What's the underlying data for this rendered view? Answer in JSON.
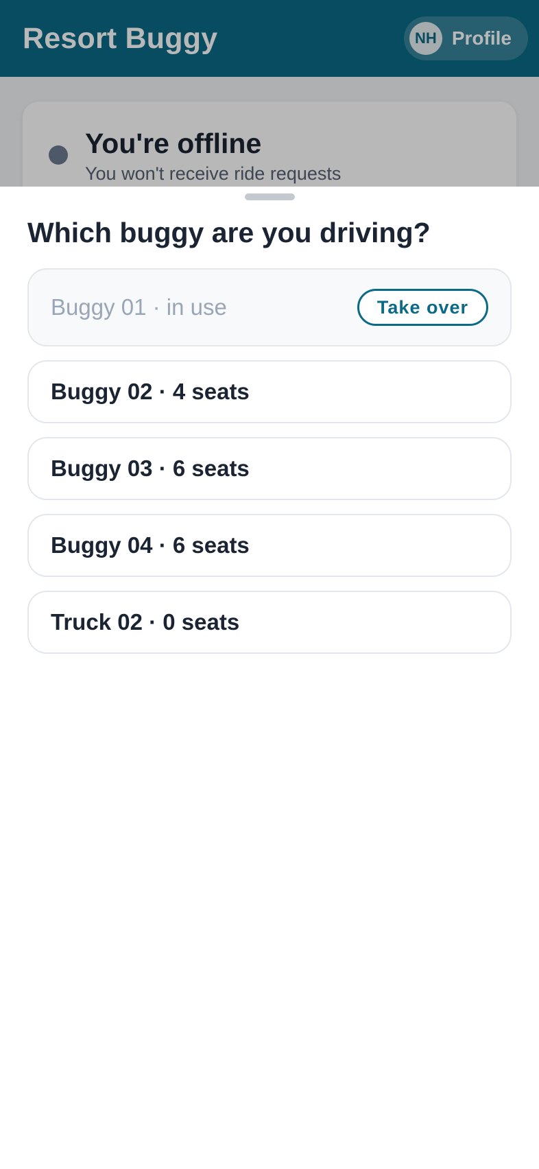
{
  "app_bar": {
    "title": "Resort Buggy",
    "profile": {
      "initials": "NH",
      "label": "Profile"
    }
  },
  "status_card": {
    "title": "You're offline",
    "subtitle": "You won't receive ride requests"
  },
  "sheet": {
    "title": "Which buggy are you driving?",
    "options": [
      {
        "label": "Buggy 01 · in use",
        "action_label": "Take over",
        "state": "in-use"
      },
      {
        "label": "Buggy 02 · 4 seats",
        "state": "available"
      },
      {
        "label": "Buggy 03 · 6 seats",
        "state": "available"
      },
      {
        "label": "Buggy 04 · 6 seats",
        "state": "available"
      },
      {
        "label": "Truck 02 · 0 seats",
        "state": "available"
      }
    ]
  },
  "colors": {
    "brand": "#0b6a86",
    "text_primary": "#1b2433",
    "text_disabled": "#9aa6b6",
    "offline_dot": "#6b7a90"
  }
}
